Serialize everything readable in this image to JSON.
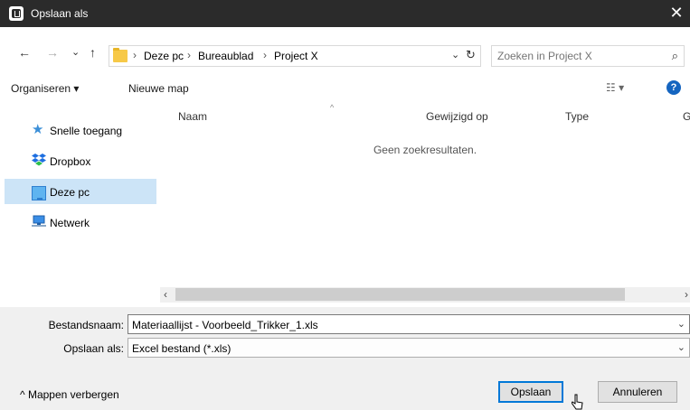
{
  "window": {
    "title": "Opslaan als",
    "close_glyph": "✕"
  },
  "nav": {
    "back_glyph": "←",
    "forward_glyph": "→",
    "recent_glyph": "⌄",
    "up_glyph": "↑",
    "breadcrumbs": [
      "Deze pc",
      "Bureaublad",
      "Project X"
    ],
    "separator": "›",
    "dropdown_glyph": "⌄",
    "refresh_glyph": "↻"
  },
  "search": {
    "placeholder": "Zoeken in Project X",
    "icon": "search-icon"
  },
  "toolbar": {
    "organize": "Organiseren ▾",
    "new_folder": "Nieuwe map",
    "view_glyph": "☷ ▾",
    "help_glyph": "?"
  },
  "sidebar": {
    "items": [
      {
        "label": "Snelle toegang",
        "icon": "star-icon"
      },
      {
        "label": "Dropbox",
        "icon": "dropbox-icon"
      },
      {
        "label": "Deze pc",
        "icon": "computer-icon",
        "selected": true
      },
      {
        "label": "Netwerk",
        "icon": "network-icon"
      }
    ]
  },
  "file_list": {
    "columns": [
      "Naam",
      "Gewijzigd op",
      "Type",
      "G"
    ],
    "sort_glyph": "^",
    "empty_message": "Geen zoekresultaten.",
    "scroll_left": "‹",
    "scroll_right": "›"
  },
  "form": {
    "filename_label": "Bestandsnaam:",
    "filename_value": "Materiaallijst - Voorbeeld_Trikker_1.xls",
    "type_label": "Opslaan als:",
    "type_value": "Excel bestand (*.xls)",
    "dropdown_glyph": "⌄"
  },
  "footer": {
    "hide_folders": "^ Mappen verbergen",
    "save": "Opslaan",
    "cancel": "Annuleren"
  },
  "colors": {
    "titlebar": "#2b2b2b",
    "accent": "#0078d7",
    "selected": "#cce4f7",
    "help": "#1565c0"
  }
}
